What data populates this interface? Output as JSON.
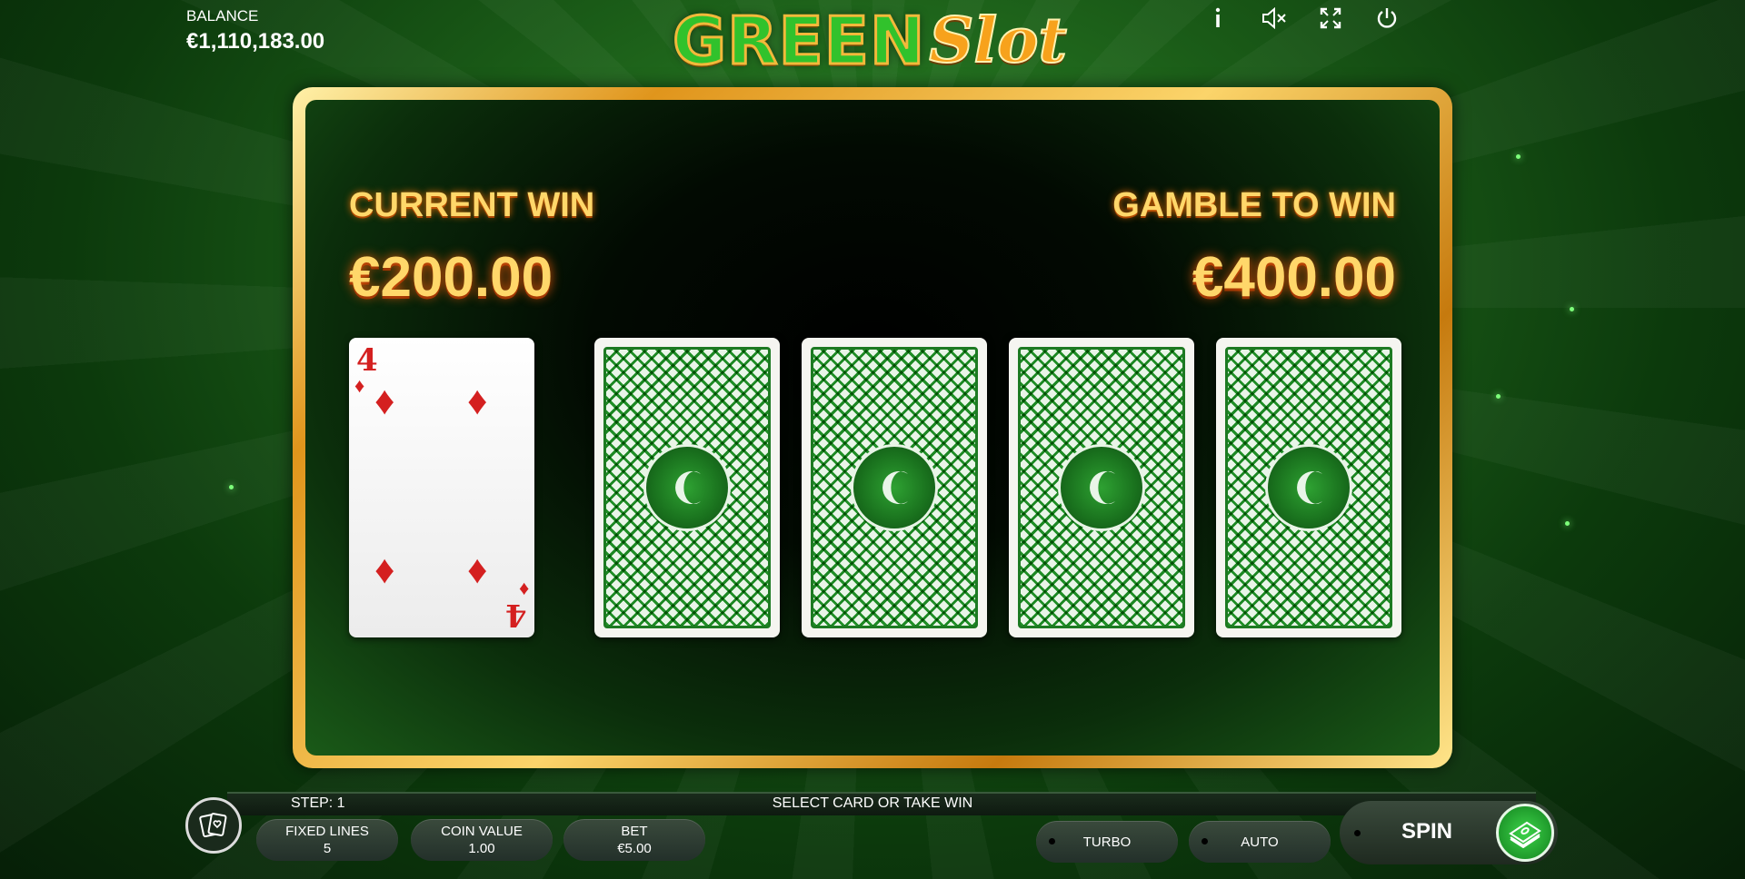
{
  "header": {
    "balance_label": "BALANCE",
    "balance_value": "€1,110,183.00",
    "logo_green": "GREEN",
    "logo_slot": "Slot",
    "icons": [
      "info-icon",
      "mute-icon",
      "fullscreen-icon",
      "power-icon"
    ]
  },
  "gamble": {
    "current_win_label": "CURRENT WIN",
    "current_win_value": "€200.00",
    "gamble_label": "GAMBLE TO WIN",
    "gamble_value": "€400.00",
    "dealer_card": {
      "rank": "4",
      "suit": "♦"
    },
    "face_down_cards": 4
  },
  "bottom": {
    "step_label": "STEP: 1",
    "status": "SELECT CARD OR TAKE WIN",
    "fixed_lines_label": "FIXED LINES",
    "fixed_lines_value": "5",
    "coin_value_label": "COIN VALUE",
    "coin_value_value": "1.00",
    "bet_label": "BET",
    "bet_value": "€5.00",
    "turbo_label": "TURBO",
    "auto_label": "AUTO",
    "spin_label": "SPIN"
  },
  "colors": {
    "frame_gold": "#e0951c",
    "win_text": "#ffd76a",
    "suit_red": "#d42020",
    "card_back_green": "#1f8e26"
  }
}
